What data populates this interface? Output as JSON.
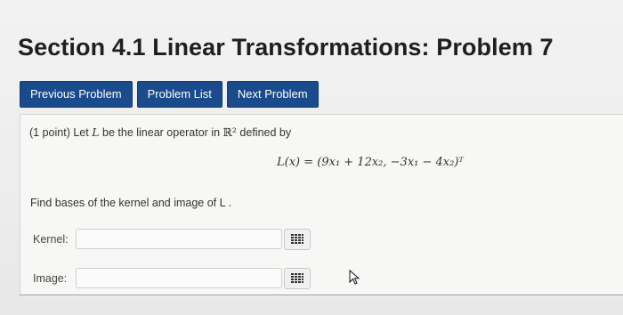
{
  "header": {
    "title": "Section 4.1 Linear Transformations: Problem 7"
  },
  "nav": {
    "previous_label": "Previous Problem",
    "list_label": "Problem List",
    "next_label": "Next Problem",
    "color": "#1a4b8c"
  },
  "problem": {
    "points": "(1 point)",
    "intro_let": "Let",
    "operator_symbol": "L",
    "intro_mid": "be the linear operator in",
    "space": "ℝ²",
    "intro_end": "defined by",
    "equation": "L(x) = (9x₁ + 12x₂, −3x₁ − 4x₂)ᵀ",
    "instruction": "Find bases of the kernel and image of L ."
  },
  "answers": {
    "kernel_label": "Kernel:",
    "kernel_value": "",
    "image_label": "Image:",
    "image_value": "",
    "matrix_icon": "matrix-grid-icon"
  }
}
